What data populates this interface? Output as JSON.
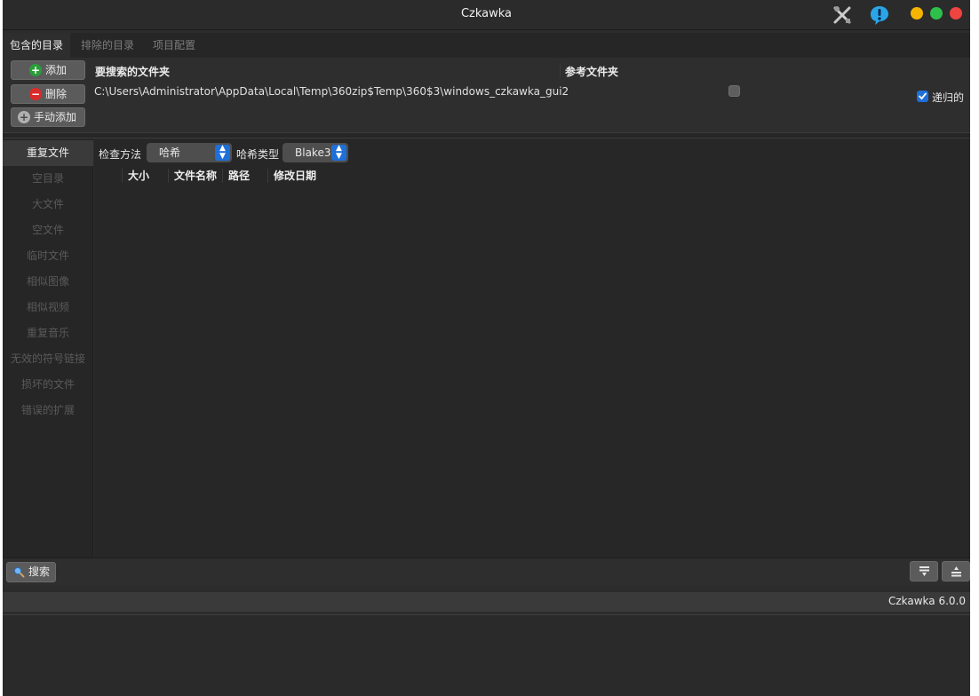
{
  "window": {
    "title": "Czkawka"
  },
  "tabs": [
    {
      "label": "包含的目录"
    },
    {
      "label": "排除的目录"
    },
    {
      "label": "项目配置"
    }
  ],
  "directories": {
    "add_label": "添加",
    "delete_label": "删除",
    "manual_add_label": "手动添加",
    "column_search": "要搜索的文件夹",
    "column_reference": "参考文件夹",
    "path": "C:\\Users\\Administrator\\AppData\\Local\\Temp\\360zip$Temp\\360$3\\windows_czkawka_gui2",
    "reference_checked": false,
    "recursive_label": "递归的",
    "recursive_checked": true
  },
  "sidebar": {
    "items": [
      {
        "label": "重复文件"
      },
      {
        "label": "空目录"
      },
      {
        "label": "大文件"
      },
      {
        "label": "空文件"
      },
      {
        "label": "临时文件"
      },
      {
        "label": "相似图像"
      },
      {
        "label": "相似视频"
      },
      {
        "label": "重复音乐"
      },
      {
        "label": "无效的符号链接"
      },
      {
        "label": "损坏的文件"
      },
      {
        "label": "错误的扩展"
      }
    ]
  },
  "main": {
    "check_method_label": "检查方法",
    "check_method_value": "哈希",
    "hash_type_label": "哈希类型",
    "hash_type_value": "Blake3",
    "columns": [
      "大小",
      "文件名称",
      "路径",
      "修改日期"
    ]
  },
  "bottom": {
    "search_label": "搜索"
  },
  "status": {
    "version": "Czkawka 6.0.0"
  },
  "colors": {
    "accent": "#1f6fd8",
    "add_green": "#2a9d3a",
    "delete_red": "#d92b2b",
    "traffic_yellow": "#f4b400",
    "traffic_green": "#2ec04a",
    "traffic_red": "#ef4440"
  },
  "icons": [
    "tools-icon",
    "info-icon",
    "plus-circle-icon",
    "minus-circle-icon",
    "search-icon",
    "sort-down-icon",
    "sort-up-icon"
  ]
}
